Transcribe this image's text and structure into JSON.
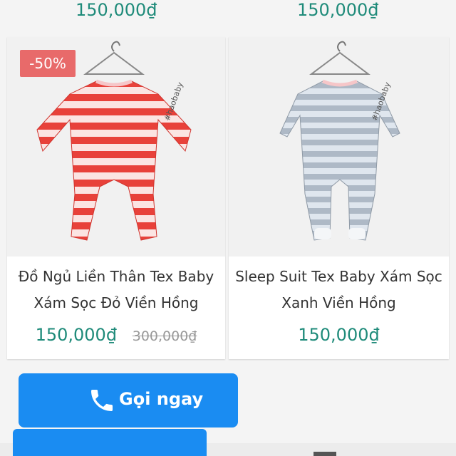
{
  "previous_row": {
    "left_price": "150,000₫",
    "right_price": "150,000₫"
  },
  "products": [
    {
      "discount_badge": "-50%",
      "brand_tag": "#haobaby",
      "image_icon": "red-striped-sleepsuit-image",
      "title_line1": "Đồ Ngủ Liền Thân Tex Baby",
      "title_line2": "Xám Sọc Đỏ Viền Hồng",
      "price": "150,000₫",
      "old_price": "300,000₫"
    },
    {
      "brand_tag": "#haobaby",
      "image_icon": "grey-striped-sleepsuit-image",
      "title_line1": "Sleep Suit Tex Baby Xám Sọc",
      "title_line2": "Xanh Viền Hồng",
      "price": "150,000₫"
    }
  ],
  "call_button": {
    "label": "Gọi ngay",
    "icon": "phone-icon",
    "color": "#1a8cf2"
  },
  "colors": {
    "price": "#1f8b7a",
    "badge": "#e86a6a"
  }
}
